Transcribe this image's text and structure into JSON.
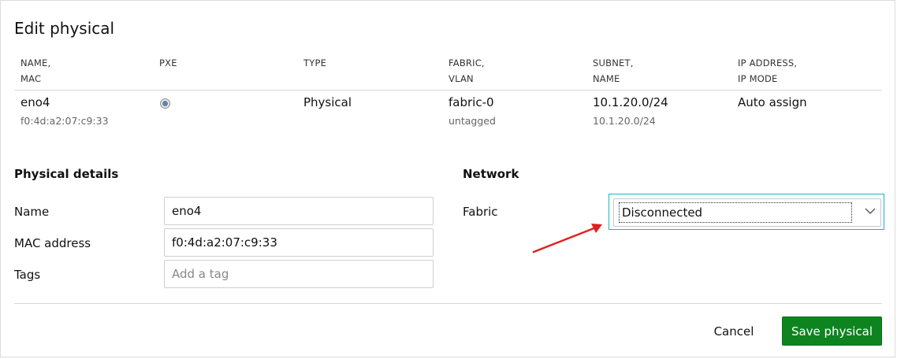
{
  "dialog": {
    "title": "Edit physical"
  },
  "table": {
    "headers": [
      {
        "line1": "NAME,",
        "line2": "MAC"
      },
      {
        "line1": "PXE",
        "line2": ""
      },
      {
        "line1": "TYPE",
        "line2": ""
      },
      {
        "line1": "FABRIC,",
        "line2": "VLAN"
      },
      {
        "line1": "SUBNET,",
        "line2": "NAME"
      },
      {
        "line1": "IP ADDRESS,",
        "line2": "IP MODE"
      }
    ],
    "row": {
      "name": "eno4",
      "mac": "f0:4d:a2:07:c9:33",
      "type": "Physical",
      "fabric": "fabric-0",
      "vlan": "untagged",
      "subnet": "10.1.20.0/24",
      "subnet_name": "10.1.20.0/24",
      "ip_mode": "Auto assign"
    }
  },
  "physical_details": {
    "title": "Physical details",
    "name_label": "Name",
    "name_value": "eno4",
    "mac_label": "MAC address",
    "mac_value": "f0:4d:a2:07:c9:33",
    "tags_label": "Tags",
    "tags_placeholder": "Add a tag"
  },
  "network": {
    "title": "Network",
    "fabric_label": "Fabric",
    "fabric_selected": "Disconnected"
  },
  "footer": {
    "cancel_label": "Cancel",
    "save_label": "Save physical"
  },
  "colors": {
    "primary_button": "#0e8420",
    "focus_outline": "#19b6c4",
    "annotation_arrow": "#e02020"
  }
}
